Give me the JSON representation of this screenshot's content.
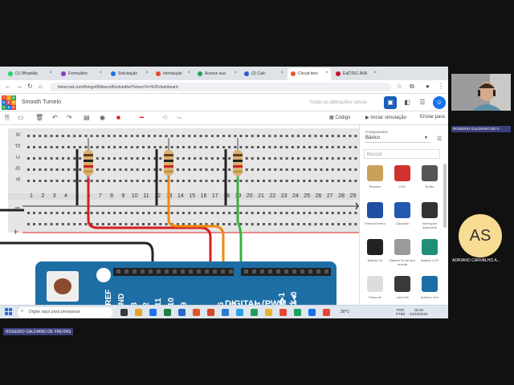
{
  "browser": {
    "tabs": [
      {
        "label": "(1) WhatsAp",
        "color": "#25d366"
      },
      {
        "label": "Formulário",
        "color": "#7b3fc4"
      },
      {
        "label": "Solicitação",
        "color": "#1a73e8"
      },
      {
        "label": "Introdução",
        "color": "#e34b2a"
      },
      {
        "label": "Acesse sua",
        "color": "#1aa260"
      },
      {
        "label": "(2) Calc",
        "color": "#2a5bd7"
      },
      {
        "label": "Circuit desi",
        "color": "#e8572a",
        "active": true
      },
      {
        "label": "EaDTEC AVA",
        "color": "#c8102e"
      }
    ],
    "url": "tinkercad.com/things/6Nbwcxd5zsh/editel?returnTo=%2Fdashboard"
  },
  "app": {
    "logo_letters": [
      "TIN",
      "KER",
      "CAD"
    ],
    "project_name": "Smooth Tumelo",
    "save_status": "Todas as alterações salvas"
  },
  "toolbar": {
    "code_label": "Código",
    "simulate_label": "Iniciar simulação",
    "send_label": "Enviar para"
  },
  "breadboard": {
    "row_letters": [
      "e",
      "d",
      "c",
      "b",
      "a"
    ],
    "columns": [
      "1",
      "2",
      "3",
      "4",
      "5",
      "6",
      "7",
      "8",
      "9",
      "10",
      "11",
      "12",
      "13",
      "14",
      "15",
      "16",
      "17",
      "18",
      "19",
      "20",
      "21",
      "22",
      "23",
      "24",
      "25",
      "26",
      "27",
      "28",
      "29"
    ],
    "rail_minus": "−",
    "rail_plus": "+"
  },
  "arduino": {
    "pin_labels": [
      "AREF",
      "GND",
      "13",
      "12",
      "~11",
      "~10",
      "~9",
      "8",
      "7",
      "~6",
      "~5",
      "4",
      "~3",
      "2",
      "TX▸1",
      "RX◂0"
    ],
    "digital_label": "DIGITAL (PWM ~)"
  },
  "panel": {
    "title": "Componentes",
    "selected": "Básico",
    "search_placeholder": "Buscar",
    "components": [
      {
        "label": "Resistor",
        "color": "#c9a15a"
      },
      {
        "label": "LED",
        "color": "#d0312d"
      },
      {
        "label": "Botão",
        "color": "#555555"
      },
      {
        "label": "Potenciômetro",
        "color": "#1f4fa0"
      },
      {
        "label": "Capacitor",
        "color": "#2358b0"
      },
      {
        "label": "Interruptor deslizante",
        "color": "#333333"
      },
      {
        "label": "Bateria 9V",
        "color": "#222222"
      },
      {
        "label": "Bateria 3V de tipo moeda",
        "color": "#9a9a9a"
      },
      {
        "label": "Bateria 1,5V",
        "color": "#1f8f7a"
      },
      {
        "label": "Placa de",
        "color": "#dddddd"
      },
      {
        "label": "micro:bit",
        "color": "#3a3a3a"
      },
      {
        "label": "Arduino Uno",
        "color": "#1e6ea6"
      }
    ]
  },
  "taskbar": {
    "search_placeholder": "Digite aqui para pesquisar",
    "temperature": "30°C",
    "lang1": "POR",
    "lang2": "PTB2",
    "time": "18:18",
    "date": "24/10/2024"
  },
  "meeting": {
    "camera_name": "ROGERIO GALDIANO DE F...",
    "avatar_initials": "AS",
    "avatar_name": "ADRIANO CARVALHO A...",
    "presenter_name": "ROGERIO GALDIANO DE FREITAS"
  }
}
